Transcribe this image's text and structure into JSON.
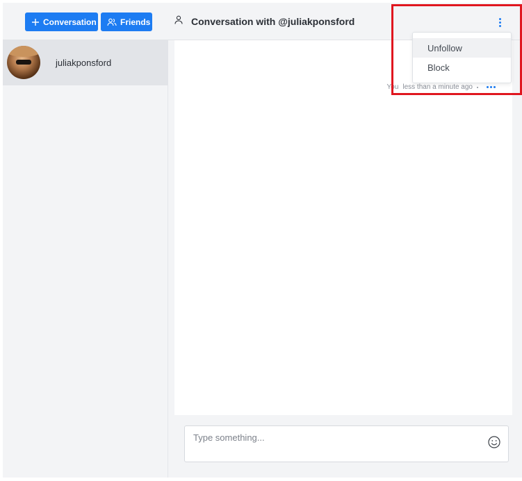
{
  "header": {
    "new_conversation_label": "Conversation",
    "friends_label": "Friends",
    "title": "Conversation with @juliakponsford",
    "accent_color": "#1d7cf2"
  },
  "sidebar": {
    "conversations": [
      {
        "name": "juliakponsford",
        "selected": true
      }
    ]
  },
  "chat": {
    "messages": [
      {
        "author": "You",
        "time": "less than a minute ago"
      }
    ]
  },
  "composer": {
    "placeholder": "Type something..."
  },
  "menu": {
    "items": [
      {
        "label": "Unfollow"
      },
      {
        "label": "Block"
      }
    ]
  },
  "highlight_color": "#e0161f"
}
